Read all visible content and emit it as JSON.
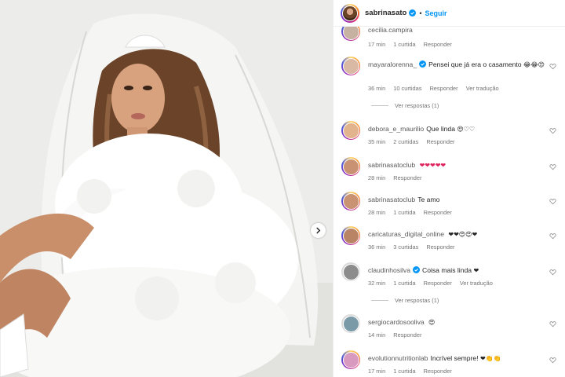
{
  "post": {
    "username": "sabrinasato",
    "follow_label": "Seguir",
    "separator": "•"
  },
  "icons": {
    "verified": "verified-badge-icon",
    "heart": "heart-outline-icon",
    "next": "chevron-right-icon"
  },
  "colors": {
    "link_blue": "#0095f6",
    "verified_blue": "#0095f6",
    "meta_gray": "#737373"
  },
  "comments": [
    {
      "username": "cecilia.campira",
      "text": "",
      "emoji": "",
      "time": "17 min",
      "likes": "1 curtida",
      "reply_label": "Responder",
      "translate_label": ""
    },
    {
      "username": "mayaralorenna_",
      "verified": true,
      "text": "Pensei que já era o casamento",
      "emoji": "😂😂😍",
      "time": "36 min",
      "likes": "10 curtidas",
      "reply_label": "Responder",
      "translate_label": "Ver tradução",
      "view_replies": "Ver respostas (1)"
    },
    {
      "username": "debora_e_maurilio",
      "text": "Que linda",
      "emoji": "😍♡♡",
      "time": "35 min",
      "likes": "2 curtidas",
      "reply_label": "Responder"
    },
    {
      "username": "sabrinasatoclub",
      "text": "",
      "emoji": "❤❤❤❤❤",
      "time": "28 min",
      "likes": "",
      "reply_label": "Responder"
    },
    {
      "username": "sabrinasatoclub",
      "text": "Te amo",
      "emoji": "",
      "time": "28 min",
      "likes": "1 curtida",
      "reply_label": "Responder"
    },
    {
      "username": "caricaturas_digital_online",
      "text": "",
      "emoji": "❤❤😍😍❤",
      "time": "36 min",
      "likes": "3 curtidas",
      "reply_label": "Responder"
    },
    {
      "username": "claudinhosilva",
      "verified": true,
      "text": "Coisa mais linda",
      "emoji": "❤",
      "time": "32 min",
      "likes": "1 curtida",
      "reply_label": "Responder",
      "translate_label": "Ver tradução",
      "view_replies": "Ver respostas (1)"
    },
    {
      "username": "sergiocardosooliva",
      "text": "",
      "emoji": "😍",
      "time": "14 min",
      "likes": "",
      "reply_label": "Responder"
    },
    {
      "username": "evolutionnutritionlab",
      "text": "Incrível sempre!",
      "emoji": "❤👏👏",
      "time": "17 min",
      "likes": "1 curtida",
      "reply_label": "Responder"
    }
  ]
}
